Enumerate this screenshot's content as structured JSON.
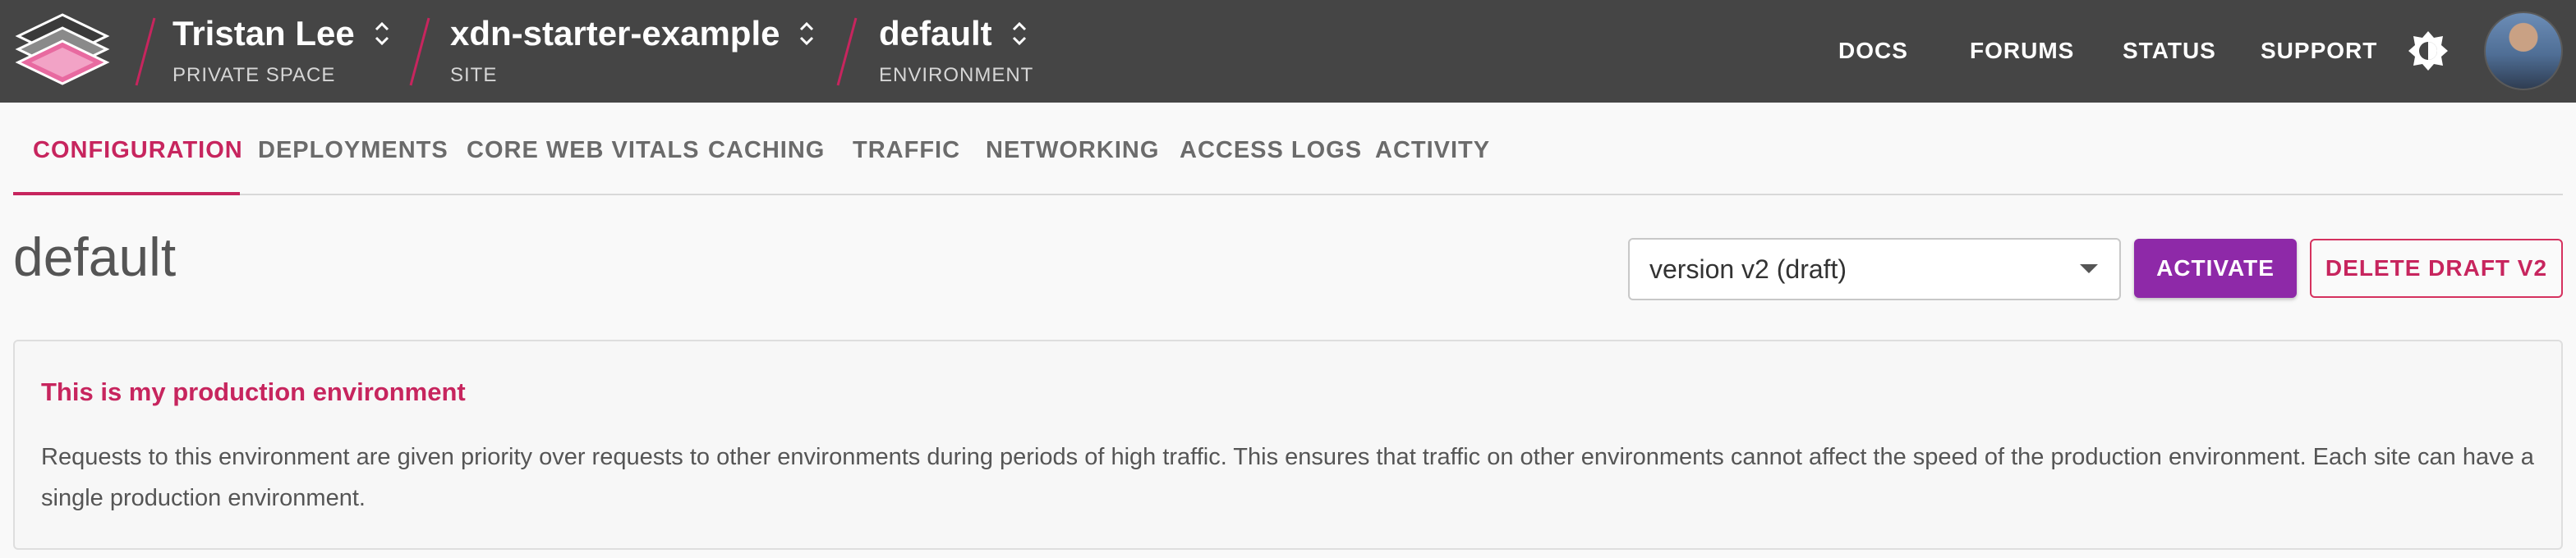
{
  "colors": {
    "topbar_bg": "#454545",
    "accent_pink": "#c7255e",
    "activate_purple": "#8e29a8"
  },
  "header": {
    "logo_icon": "stacked-layers-logo",
    "breadcrumbs": [
      {
        "title": "Tristan Lee",
        "subtitle": "PRIVATE SPACE"
      },
      {
        "title": "xdn-starter-example",
        "subtitle": "SITE"
      },
      {
        "title": "default",
        "subtitle": "ENVIRONMENT"
      }
    ],
    "nav": [
      {
        "label": "DOCS"
      },
      {
        "label": "FORUMS"
      },
      {
        "label": "STATUS"
      },
      {
        "label": "SUPPORT"
      }
    ],
    "theme_toggle_icon": "brightness-icon",
    "avatar_icon": "user-avatar"
  },
  "tabs": {
    "items": [
      {
        "label": "CONFIGURATION",
        "active": true
      },
      {
        "label": "DEPLOYMENTS"
      },
      {
        "label": "CORE WEB VITALS"
      },
      {
        "label": "CACHING"
      },
      {
        "label": "TRAFFIC"
      },
      {
        "label": "NETWORKING"
      },
      {
        "label": "ACCESS LOGS"
      },
      {
        "label": "ACTIVITY"
      }
    ]
  },
  "main": {
    "title": "default",
    "version_select": {
      "value": "version v2 (draft)"
    },
    "activate_label": "ACTIVATE",
    "delete_label": "DELETE DRAFT V2",
    "panel": {
      "title": "This is my production environment",
      "body": "Requests to this environment are given priority over requests to other environments during periods of high traffic. This ensures that traffic on other environments cannot affect the speed of the production environment. Each site can have a single production environment."
    }
  }
}
